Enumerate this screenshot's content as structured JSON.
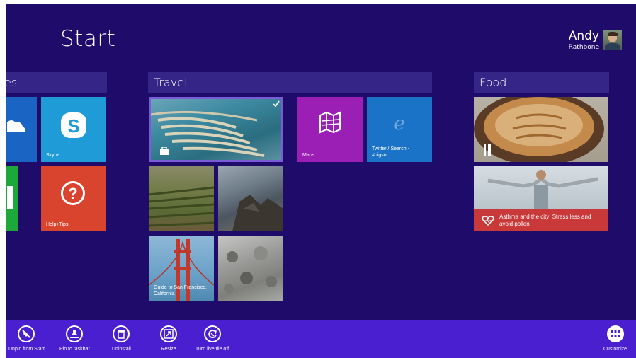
{
  "start": {
    "title": "Start"
  },
  "user": {
    "first_name": "Andy",
    "last_name": "Rathbone"
  },
  "groups": {
    "left_partial": "es",
    "travel": "Travel",
    "food": "Food"
  },
  "tiles": {
    "skype": "Skype",
    "help": "Help+Tips",
    "maps": "Maps",
    "twitter": "Twitter / Search -\n#bigsur",
    "guide_sf": "Guide to San Francisco, California",
    "health": "Asthma and the city: Stress less and avoid pollen"
  },
  "appbar": {
    "unpin": "Unpin from Start",
    "pin_taskbar": "Pin to taskbar",
    "uninstall": "Uninstall",
    "resize": "Resize",
    "live_tile": "Turn live tile off",
    "customize": "Customize"
  },
  "colors": {
    "background": "#1f0b6a",
    "header": "#352587",
    "appbar": "#4a1fcf",
    "skype": "#1f9bd7",
    "help": "#d9442e",
    "maps": "#9b1fb4",
    "ie": "#1a73c6",
    "health": "#c9393a"
  }
}
